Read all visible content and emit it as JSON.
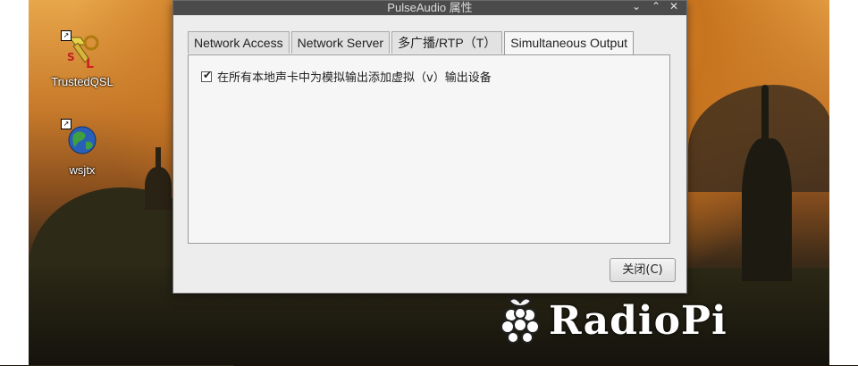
{
  "desktop": {
    "icons": [
      {
        "label": "TrustedQSL"
      },
      {
        "label": "wsjtx"
      }
    ],
    "branding": {
      "text": "RadioPi"
    }
  },
  "window": {
    "title": "PulseAudio 属性",
    "controls": {
      "menu": "⌄",
      "minimize": "⌃",
      "close": "✕"
    },
    "tabs": [
      {
        "label": "Network Access",
        "active": false
      },
      {
        "label": "Network Server",
        "active": false
      },
      {
        "label": "多广播/RTP（T）",
        "active": false
      },
      {
        "label": "Simultaneous Output",
        "active": true
      }
    ],
    "panel": {
      "checkbox_label": "在所有本地声卡中为模拟输出添加虚拟（v）输出设备",
      "checked": true
    },
    "close_button": "关闭(C)"
  },
  "colors": {
    "titlebar": "#4b4b4b",
    "window_bg": "#ededed",
    "panel_bg": "#f6f6f6"
  }
}
